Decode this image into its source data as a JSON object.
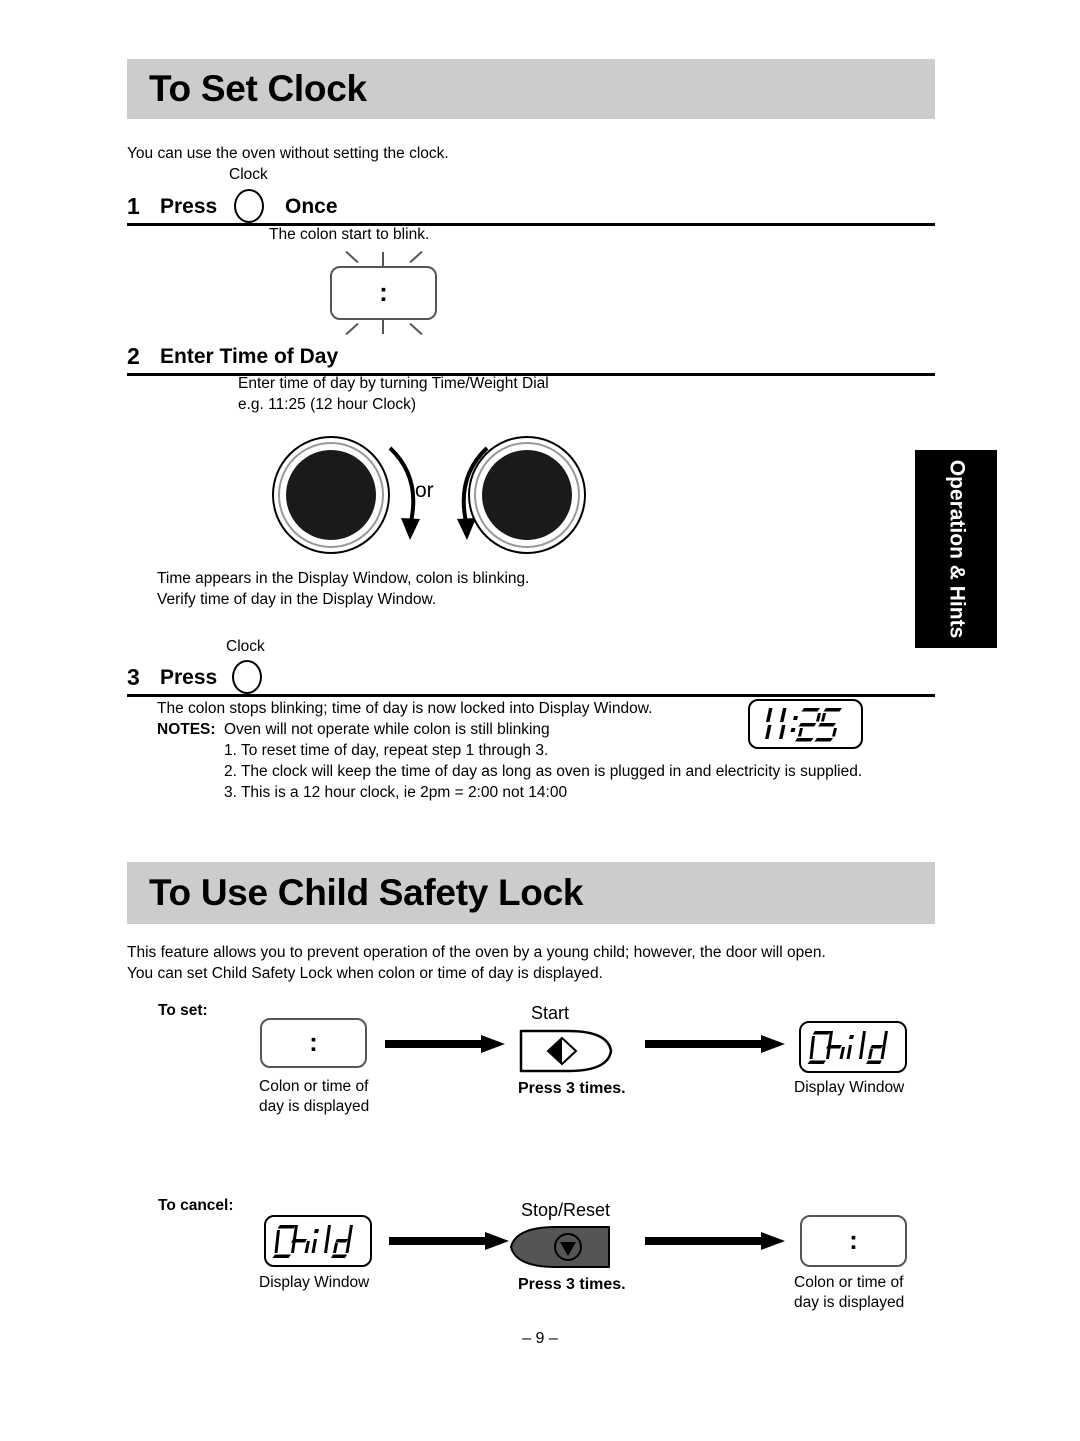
{
  "page": {
    "footer": "– 9 –"
  },
  "side_tab": {
    "label": "Operation & Hints"
  },
  "section_clock": {
    "title": "To Set Clock",
    "intro": "You can use the oven without setting the clock.",
    "step1": {
      "number": "1",
      "press_label": "Press",
      "button_name": "Clock",
      "once_label": "Once",
      "note": "The colon start to blink.",
      "display_value": ":"
    },
    "step2": {
      "number": "2",
      "heading": "Enter Time of Day",
      "line1": "Enter time of day by turning Time/Weight Dial",
      "line2": "e.g. 11:25 (12 hour Clock)",
      "or_label": "or",
      "after_line1": "Time appears in the Display Window, colon is blinking.",
      "after_line2": "Verify time of day in the Display Window."
    },
    "step3": {
      "number": "3",
      "press_label": "Press",
      "button_name": "Clock",
      "line1": "The colon stops blinking; time of day is now locked into Display Window.",
      "notes_label": "NOTES:",
      "notes_lead": "Oven will not operate while colon is still blinking",
      "notes": [
        "1. To reset time of day, repeat step 1 through 3.",
        "2. The clock will keep the time of day as long as oven is plugged in and electricity is supplied.",
        "3. This is a 12 hour clock, ie 2pm = 2:00 not 14:00"
      ],
      "display_value": "11:25"
    }
  },
  "section_child_lock": {
    "title": "To Use Child Safety Lock",
    "intro_line1": "This feature allows you to prevent operation of the oven by a young child; however, the door will open.",
    "intro_line2": "You can set Child Safety Lock when colon or time of day is displayed.",
    "to_set": {
      "label": "To set:",
      "start_display_value": ":",
      "start_display_caption_line1": "Colon or time of",
      "start_display_caption_line2": "day is displayed",
      "button_name": "Start",
      "button_instruction": "Press 3 times.",
      "end_display_value": "Child",
      "end_display_caption": "Display Window"
    },
    "to_cancel": {
      "label": "To cancel:",
      "start_display_value": "Child",
      "start_display_caption": "Display Window",
      "button_name": "Stop/Reset",
      "button_instruction": "Press 3 times.",
      "end_display_value": ":",
      "end_display_caption_line1": "Colon or time of",
      "end_display_caption_line2": "day is displayed"
    }
  }
}
